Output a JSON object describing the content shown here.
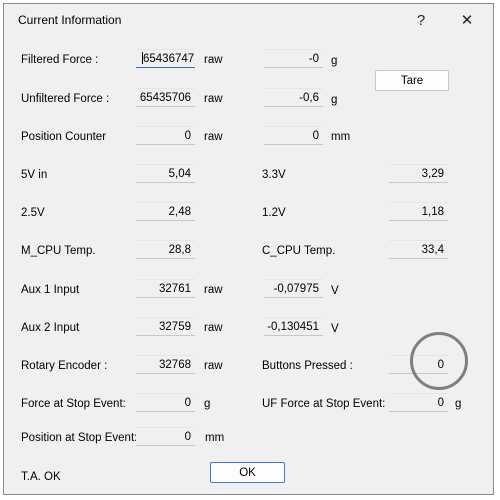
{
  "window": {
    "title": "Current Information",
    "help_glyph": "?",
    "close_glyph": "✕"
  },
  "rows": {
    "filtered_force": {
      "label": "Filtered Force :",
      "raw_value": "65436747",
      "raw_unit": "raw",
      "value": "-0",
      "unit": "g"
    },
    "unfiltered_force": {
      "label": "Unfiltered Force :",
      "raw_value": "65435706",
      "raw_unit": "raw",
      "value": "-0,6",
      "unit": "g"
    },
    "position_counter": {
      "label": "Position Counter",
      "raw_value": "0",
      "raw_unit": "raw",
      "value": "0",
      "unit": "mm"
    },
    "v5": {
      "label": "5V in",
      "value": "5,04"
    },
    "v3_3": {
      "label": "3.3V",
      "value": "3,29"
    },
    "v2_5": {
      "label": "2.5V",
      "value": "2,48"
    },
    "v1_2": {
      "label": "1.2V",
      "value": "1,18"
    },
    "m_cpu_temp": {
      "label": "M_CPU Temp.",
      "value": "28,8"
    },
    "c_cpu_temp": {
      "label": "C_CPU Temp.",
      "value": "33,4"
    },
    "aux1": {
      "label": "Aux 1 Input",
      "raw_value": "32761",
      "raw_unit": "raw",
      "value": "-0,07975",
      "unit": "V"
    },
    "aux2": {
      "label": "Aux 2 Input",
      "raw_value": "32759",
      "raw_unit": "raw",
      "value": "-0,130451",
      "unit": "V"
    },
    "rotary_encoder": {
      "label": "Rotary Encoder :",
      "raw_value": "32768",
      "raw_unit": "raw"
    },
    "buttons_pressed": {
      "label": "Buttons Pressed :",
      "value": "0"
    },
    "force_stop": {
      "label": "Force at Stop Event:",
      "value": "0",
      "unit": "g"
    },
    "uf_force_stop": {
      "label": "UF Force at Stop Event:",
      "value": "0",
      "unit": "g"
    },
    "position_stop": {
      "label": "Position at Stop Event:",
      "value": "0",
      "unit": "mm"
    }
  },
  "buttons": {
    "tare": "Tare",
    "ok": "OK"
  },
  "status": "T.A. OK"
}
